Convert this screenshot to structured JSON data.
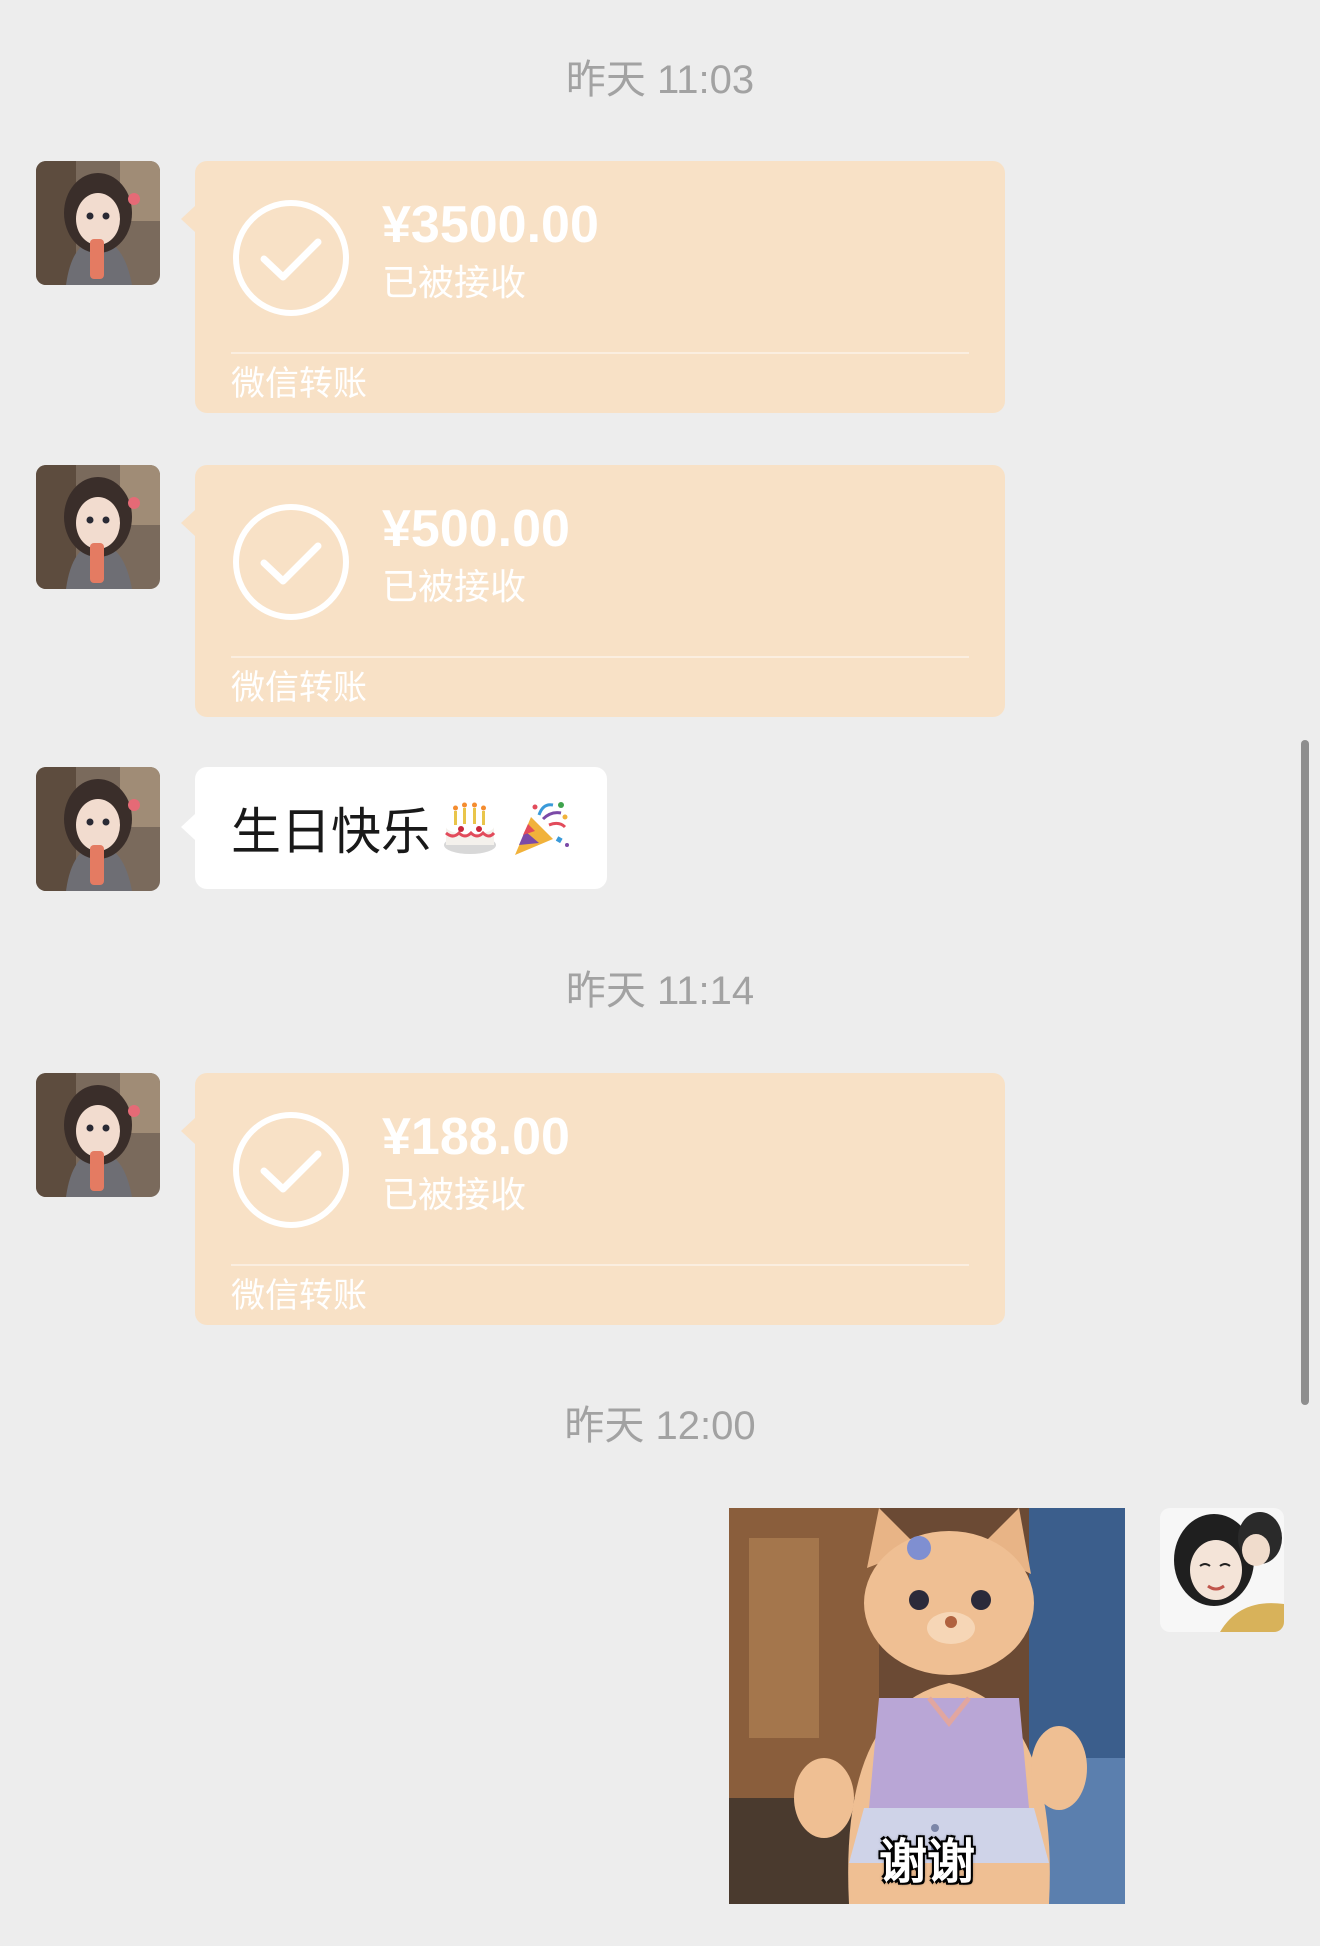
{
  "messages": {
    "timestamp_1": "昨天 11:03",
    "transfer_1": {
      "amount": "¥3500.00",
      "status": "已被接收",
      "label": "微信转账"
    },
    "transfer_2": {
      "amount": "¥500.00",
      "status": "已被接收",
      "label": "微信转账"
    },
    "text_1": {
      "text": "生日快乐",
      "emojis": [
        "birthday-cake",
        "party-popper"
      ]
    },
    "timestamp_2": "昨天 11:14",
    "transfer_3": {
      "amount": "¥188.00",
      "status": "已被接收",
      "label": "微信转账"
    },
    "timestamp_3": "昨天 12:00",
    "sticker_1": {
      "caption": "谢谢",
      "subject": "plush fox sticker"
    }
  },
  "colors": {
    "background": "#ededed",
    "transfer_bubble": "#f8e1c6",
    "text_bubble": "#ffffff",
    "timestamp": "#a2a2a2"
  }
}
